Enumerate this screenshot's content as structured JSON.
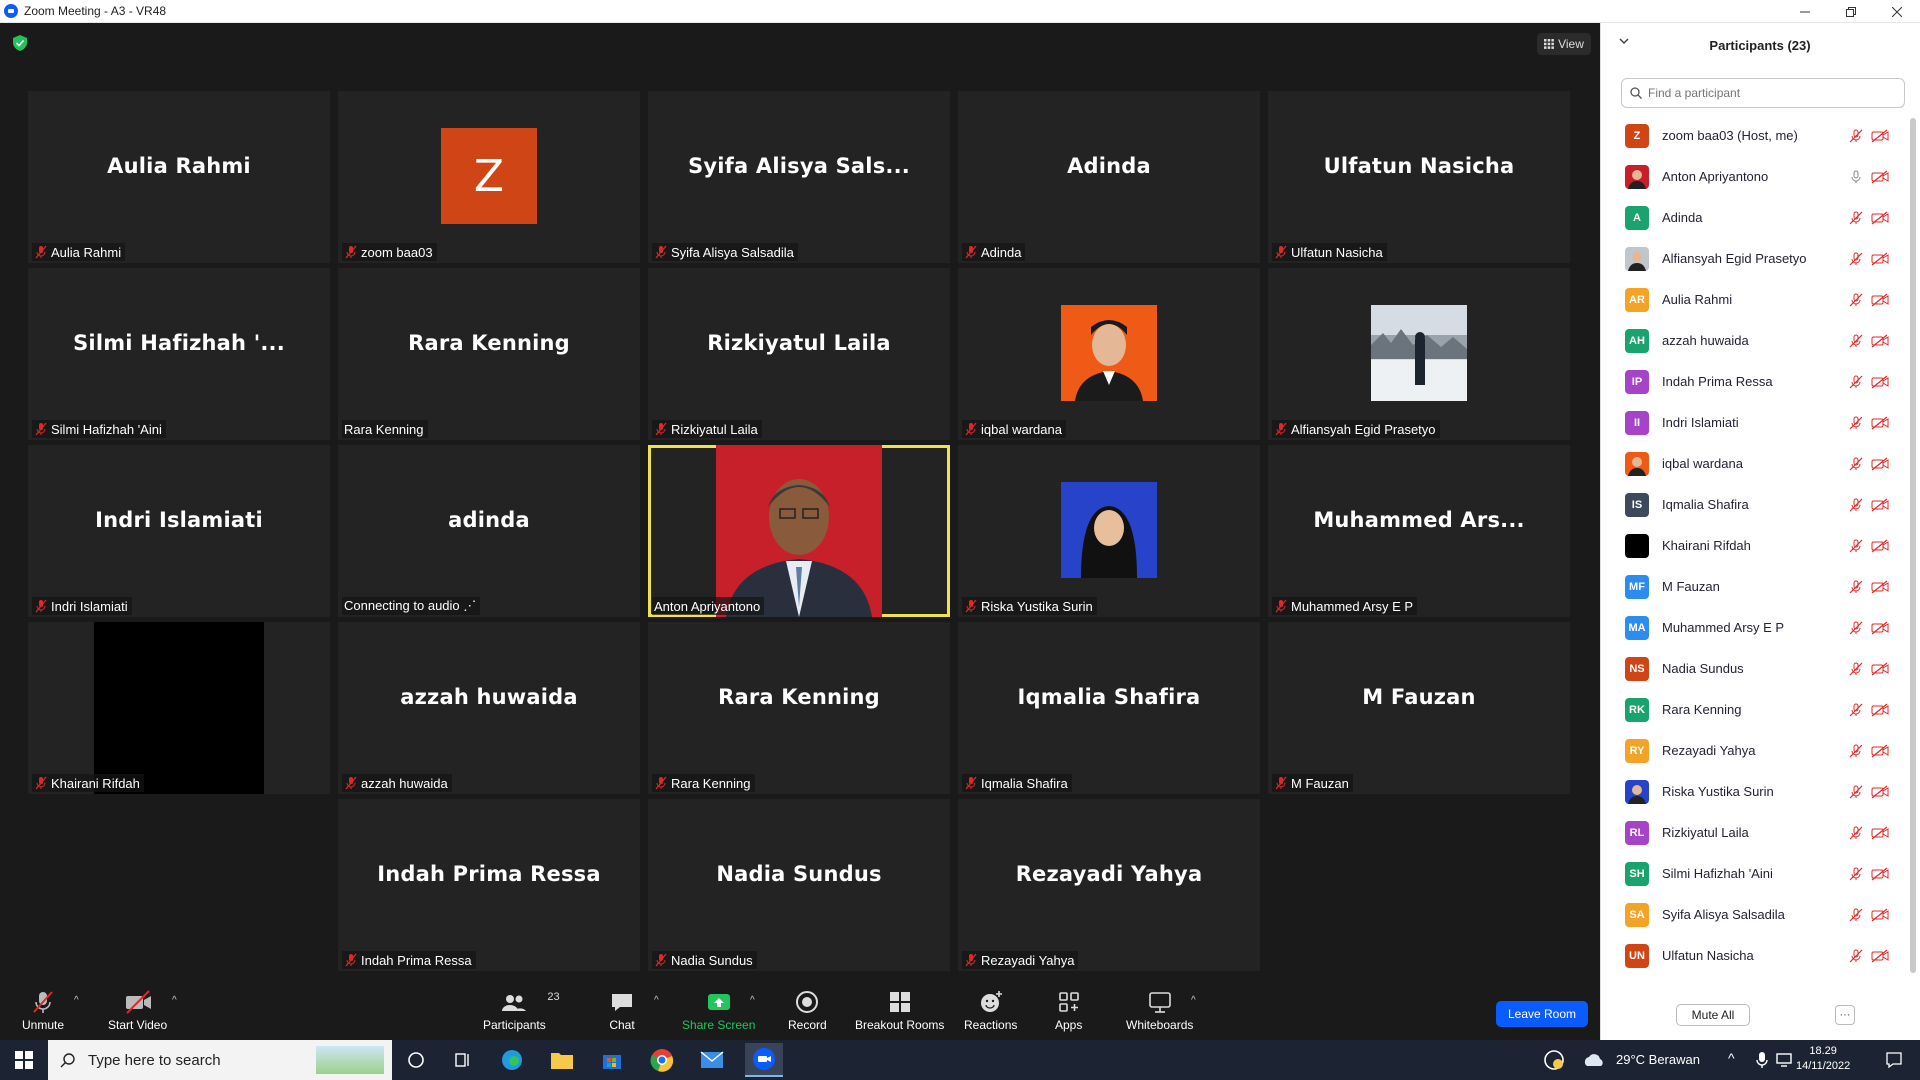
{
  "window": {
    "title": "Zoom Meeting - A3 - VR48"
  },
  "header": {
    "view_label": "View"
  },
  "tiles": [
    {
      "display": "Aulia Rahmi",
      "label": "Aulia Rahmi",
      "muted": true
    },
    {
      "display": "Z",
      "label": "zoom baa03",
      "muted": true
    },
    {
      "display": "Syifa  Alisya  Sals...",
      "label": "Syifa Alisya Salsadila",
      "muted": true
    },
    {
      "display": "Adinda",
      "label": "Adinda",
      "muted": true
    },
    {
      "display": "Ulfatun Nasicha",
      "label": "Ulfatun Nasicha",
      "muted": true
    },
    {
      "display": "Silmi  Hafizhah  '...",
      "label": "Silmi Hafizhah 'Aini",
      "muted": true
    },
    {
      "display": "Rara Kenning",
      "label": "Rara Kenning",
      "muted": false
    },
    {
      "display": "Rizkiyatul Laila",
      "label": "Rizkiyatul Laila",
      "muted": true
    },
    {
      "display": "",
      "label": "iqbal wardana",
      "muted": true
    },
    {
      "display": "",
      "label": "Alfiansyah Egid Prasetyo",
      "muted": true
    },
    {
      "display": "Indri Islamiati",
      "label": "Indri Islamiati",
      "muted": true
    },
    {
      "display": "adinda",
      "label": "Connecting to audio ⋰",
      "muted": false
    },
    {
      "display": "",
      "label": "Anton Apriyantono",
      "muted": false
    },
    {
      "display": "",
      "label": "Riska Yustika Surin",
      "muted": true
    },
    {
      "display": "Muhammed  Ars...",
      "label": "Muhammed Arsy E P",
      "muted": true
    },
    {
      "display": "",
      "label": "Khairani Rifdah",
      "muted": true
    },
    {
      "display": "azzah huwaida",
      "label": "azzah huwaida",
      "muted": true
    },
    {
      "display": "Rara Kenning",
      "label": "Rara Kenning",
      "muted": true
    },
    {
      "display": "Iqmalia Shafira",
      "label": "Iqmalia Shafira",
      "muted": true
    },
    {
      "display": "M Fauzan",
      "label": "M Fauzan",
      "muted": true
    },
    {
      "display": "Indah Prima Ressa",
      "label": "Indah Prima Ressa",
      "muted": true
    },
    {
      "display": "Nadia Sundus",
      "label": "Nadia Sundus",
      "muted": true
    },
    {
      "display": "Rezayadi Yahya",
      "label": "Rezayadi Yahya",
      "muted": true
    }
  ],
  "toolbar": {
    "unmute": "Unmute",
    "start_video": "Start Video",
    "participants": "Participants",
    "participants_count": "23",
    "chat": "Chat",
    "share_screen": "Share Screen",
    "record": "Record",
    "breakout_rooms": "Breakout Rooms",
    "reactions": "Reactions",
    "apps": "Apps",
    "whiteboards": "Whiteboards",
    "leave_room": "Leave Room"
  },
  "panel": {
    "title": "Participants (23)",
    "search_placeholder": "Find a participant",
    "mute_all": "Mute All",
    "more": "···",
    "participants": [
      {
        "initials": "Z",
        "name": "zoom baa03 (Host, me)",
        "color": "#d04516",
        "photo": false
      },
      {
        "initials": "",
        "name": "Anton Apriyantono",
        "color": "#c8202a",
        "photo": true,
        "mic_on": true
      },
      {
        "initials": "A",
        "name": "Adinda",
        "color": "#1aa36f",
        "photo": false
      },
      {
        "initials": "",
        "name": "Alfiansyah Egid Prasetyo",
        "color": "#bfc6cc",
        "photo": true
      },
      {
        "initials": "AR",
        "name": "Aulia Rahmi",
        "color": "#f3a325",
        "photo": false
      },
      {
        "initials": "AH",
        "name": "azzah huwaida",
        "color": "#1aa36f",
        "photo": false
      },
      {
        "initials": "IP",
        "name": "Indah Prima Ressa",
        "color": "#a644c7",
        "photo": false
      },
      {
        "initials": "II",
        "name": "Indri Islamiati",
        "color": "#a644c7",
        "photo": false
      },
      {
        "initials": "",
        "name": "iqbal wardana",
        "color": "#ef5a17",
        "photo": true
      },
      {
        "initials": "IS",
        "name": "Iqmalia Shafira",
        "color": "#3d4a5c",
        "photo": false
      },
      {
        "initials": "",
        "name": "Khairani Rifdah",
        "color": "#000000",
        "photo": true
      },
      {
        "initials": "MF",
        "name": "M Fauzan",
        "color": "#2d8cf0",
        "photo": false
      },
      {
        "initials": "MA",
        "name": "Muhammed Arsy E P",
        "color": "#2d8cf0",
        "photo": false
      },
      {
        "initials": "NS",
        "name": "Nadia Sundus",
        "color": "#d04516",
        "photo": false
      },
      {
        "initials": "RK",
        "name": "Rara Kenning",
        "color": "#1aa36f",
        "photo": false
      },
      {
        "initials": "RY",
        "name": "Rezayadi Yahya",
        "color": "#f3a325",
        "photo": false
      },
      {
        "initials": "",
        "name": "Riska Yustika Surin",
        "color": "#2643c9",
        "photo": true
      },
      {
        "initials": "RL",
        "name": "Rizkiyatul Laila",
        "color": "#a644c7",
        "photo": false
      },
      {
        "initials": "SH",
        "name": "Silmi Hafizhah 'Aini",
        "color": "#1aa36f",
        "photo": false
      },
      {
        "initials": "SA",
        "name": "Syifa Alisya Salsadila",
        "color": "#f3a325",
        "photo": false
      },
      {
        "initials": "UN",
        "name": "Ulfatun Nasicha",
        "color": "#d04516",
        "photo": false
      }
    ]
  },
  "taskbar": {
    "search_placeholder": "Type here to search",
    "weather": "29°C  Berawan",
    "time": "18.29",
    "date": "14/11/2022"
  },
  "colors": {
    "accent": "#0b5cff",
    "active_speaker": "#f0e24b",
    "muted": "#e02828"
  }
}
